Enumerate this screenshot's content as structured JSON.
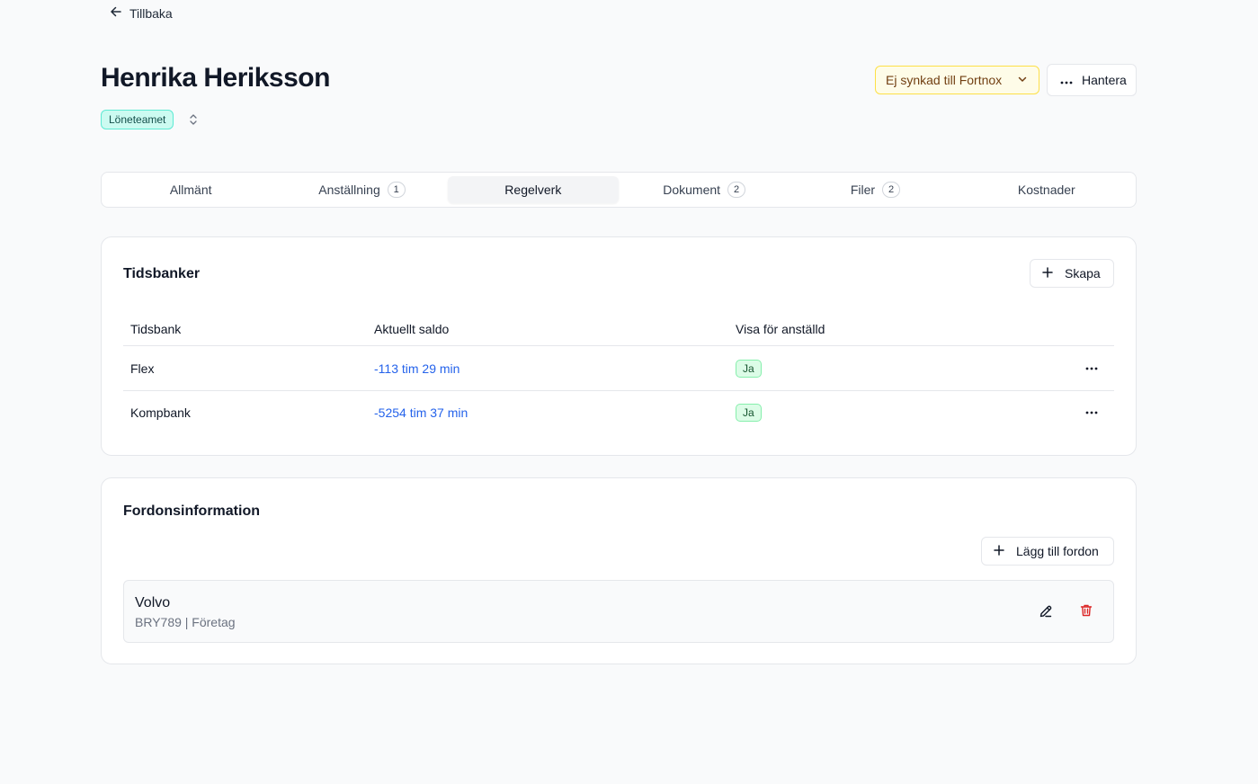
{
  "nav": {
    "back_label": "Tillbaka"
  },
  "employee": {
    "name": "Henrika Heriksson",
    "team": "Löneteamet"
  },
  "header_actions": {
    "sync_status": "Ej synkad till Fortnox",
    "manage_label": "Hantera"
  },
  "tabs": [
    {
      "label": "Allmänt",
      "count": null,
      "active": false
    },
    {
      "label": "Anställning",
      "count": "1",
      "active": false
    },
    {
      "label": "Regelverk",
      "count": null,
      "active": true
    },
    {
      "label": "Dokument",
      "count": "2",
      "active": false
    },
    {
      "label": "Filer",
      "count": "2",
      "active": false
    },
    {
      "label": "Kostnader",
      "count": null,
      "active": false
    }
  ],
  "timebanks": {
    "title": "Tidsbanker",
    "create_label": "Skapa",
    "columns": [
      "Tidsbank",
      "Aktuellt saldo",
      "Visa för anställd"
    ],
    "rows": [
      {
        "name": "Flex",
        "balance": "-113 tim 29 min",
        "show": "Ja"
      },
      {
        "name": "Kompbank",
        "balance": "-5254 tim 37 min",
        "show": "Ja"
      }
    ]
  },
  "vehicles": {
    "title": "Fordonsinformation",
    "add_label": "Lägg till fordon",
    "items": [
      {
        "name": "Volvo",
        "meta": "BRY789 | Företag"
      }
    ]
  },
  "colors": {
    "accent_blue": "#2563eb",
    "sync_warning_bg": "#fefce8",
    "team_badge_bg": "#ccfbf1",
    "yes_badge_bg": "#dcfce7",
    "delete_red": "#dc2626"
  },
  "icons": {
    "back": "arrow-left-icon",
    "sort": "chevron-up-down-icon",
    "sync_dropdown": "chevron-down-icon",
    "manage": "ellipsis-icon",
    "create": "plus-icon",
    "row_actions": "ellipsis-icon",
    "edit": "pencil-icon",
    "delete": "trash-icon"
  }
}
